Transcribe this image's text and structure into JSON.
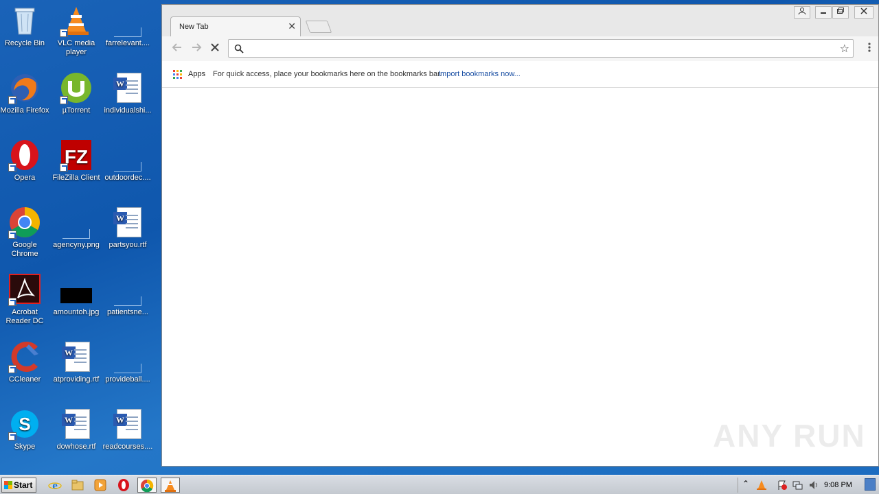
{
  "desktop": {
    "icons": [
      {
        "label": "Recycle Bin"
      },
      {
        "label": "VLC media player"
      },
      {
        "label": "farrelevant...."
      },
      {
        "label": "Mozilla Firefox"
      },
      {
        "label": "µTorrent"
      },
      {
        "label": "individualshi..."
      },
      {
        "label": "Opera"
      },
      {
        "label": "FileZilla Client"
      },
      {
        "label": "outdoordec...."
      },
      {
        "label": "Google Chrome"
      },
      {
        "label": "agencyny.png"
      },
      {
        "label": "partsyou.rtf"
      },
      {
        "label": "Acrobat Reader DC"
      },
      {
        "label": "amountoh.jpg"
      },
      {
        "label": "patientsne..."
      },
      {
        "label": "CCleaner"
      },
      {
        "label": "atproviding.rtf"
      },
      {
        "label": "provideball...."
      },
      {
        "label": "Skype"
      },
      {
        "label": "dowhose.rtf"
      },
      {
        "label": "readcourses...."
      }
    ]
  },
  "browser": {
    "tab_title": "New Tab",
    "tab_close": "✕",
    "address_value": "",
    "bookmarks": {
      "apps_label": "Apps",
      "message": "For quick access, place your bookmarks here on the bookmarks bar.",
      "import_link": "Import bookmarks now..."
    }
  },
  "watermark": "ANY RUN",
  "taskbar": {
    "start_label": "Start",
    "clock": "9:08 PM"
  },
  "colors": {
    "desktop_blue": "#1a63b8",
    "link_blue": "#1a4fa3"
  }
}
